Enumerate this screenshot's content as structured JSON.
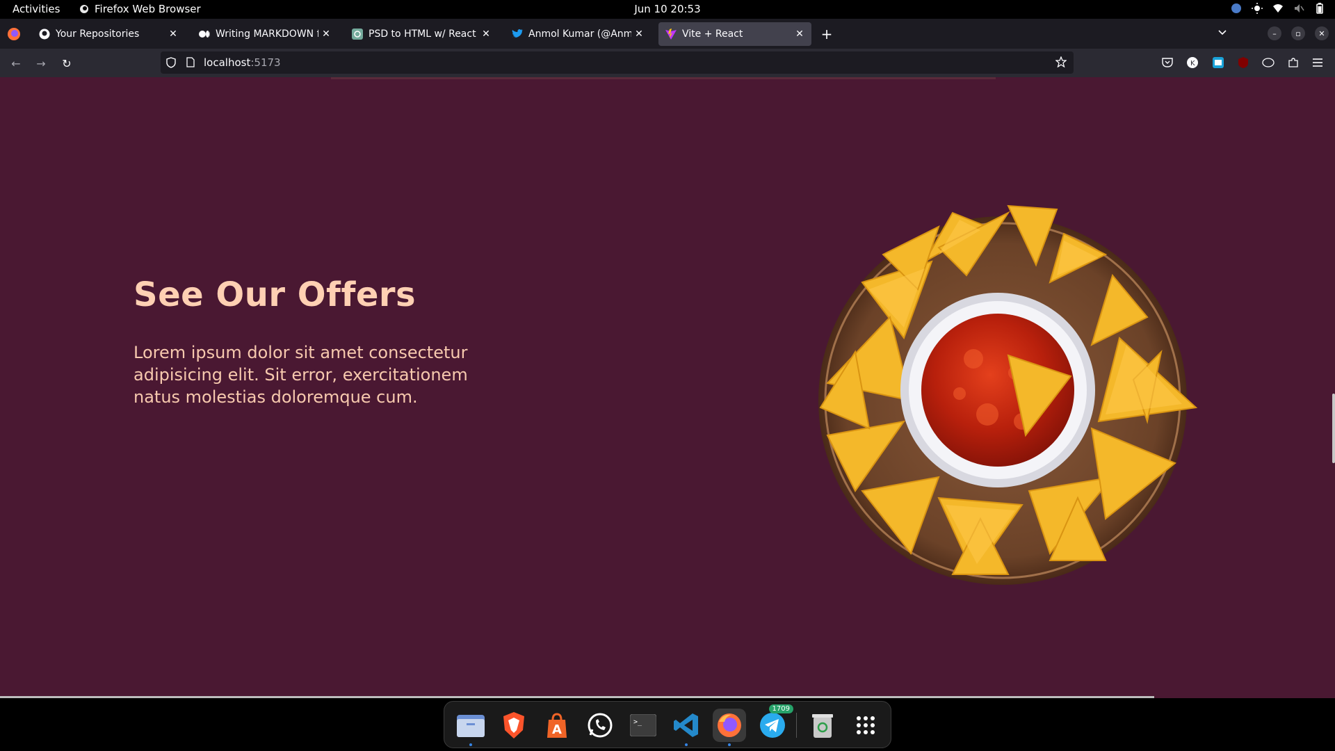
{
  "system": {
    "activities": "Activities",
    "app_name": "Firefox Web Browser",
    "clock": "Jun 10  20:53"
  },
  "tabs": [
    {
      "title": "Your Repositories",
      "icon": "github-icon"
    },
    {
      "title": "Writing MARKDOWN for your",
      "icon": "medium-icon"
    },
    {
      "title": "PSD to HTML w/ React",
      "icon": "chatgpt-icon"
    },
    {
      "title": "Anmol Kumar (@Anmol_kr",
      "icon": "twitter-icon"
    },
    {
      "title": "Vite + React",
      "icon": "vite-icon",
      "active": true
    }
  ],
  "urlbar": {
    "host": "localhost",
    "port": ":5173"
  },
  "page": {
    "heading": "See Our Offers",
    "body": "Lorem ipsum dolor sit amet consectetur adipisicing elit. Sit error, exercitationem natus molestias doloremque cum."
  },
  "dock": {
    "telegram_badge": "1709"
  },
  "colors": {
    "page_bg": "#4a1832",
    "heading": "#ffd0b3",
    "body_text": "#f7c9ae"
  }
}
